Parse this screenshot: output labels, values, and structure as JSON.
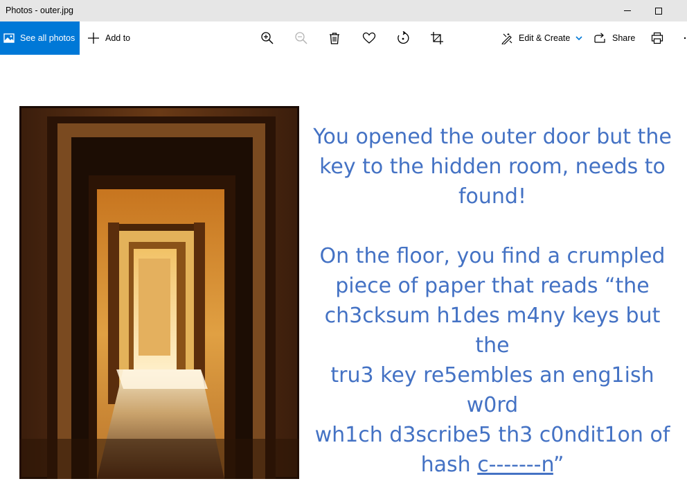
{
  "window": {
    "title": "Photos - outer.jpg"
  },
  "toolbar": {
    "see_all_label": "See all photos",
    "add_to_label": "Add to",
    "edit_label": "Edit & Create",
    "share_label": "Share",
    "accent": "#0078d7"
  },
  "message": {
    "para1": [
      "You opened the outer door but the",
      "key to the hidden room, needs to",
      "found!"
    ],
    "para2": [
      "On the floor, you find a crumpled",
      "piece of paper that reads “the",
      "ch3cksum h1des m4ny keys but the",
      "tru3 key re5embles an eng1ish w0rd",
      "wh1ch d3scribe5 th3 c0ndit1on of"
    ],
    "last_prefix": "hash ",
    "last_underlined": "c-------n",
    "last_suffix": "”",
    "color": "#4472c4"
  }
}
